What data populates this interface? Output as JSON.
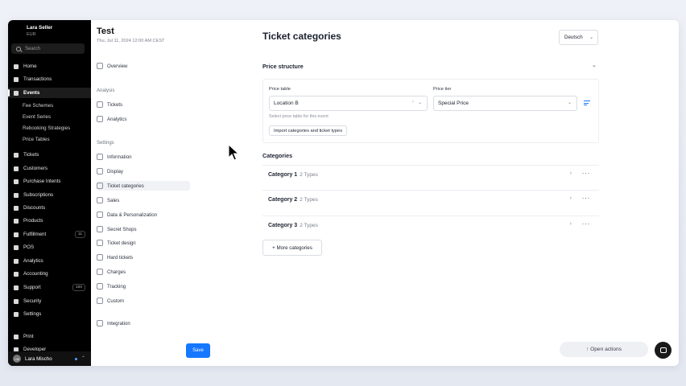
{
  "sidebar": {
    "account": {
      "name": "Lara Seller",
      "currency": "EUR"
    },
    "search_label": "Search",
    "items": [
      {
        "label": "Home",
        "icon": "home-icon"
      },
      {
        "label": "Transactions",
        "icon": "transactions-icon"
      },
      {
        "label": "Events",
        "icon": "events-icon",
        "active": true
      },
      {
        "label": "Fee Schemes",
        "sub": true
      },
      {
        "label": "Event Series",
        "sub": true
      },
      {
        "label": "Rebooking Strategies",
        "sub": true
      },
      {
        "label": "Price Tables",
        "sub": true
      },
      {
        "label": "Tickets",
        "icon": "tickets-icon"
      },
      {
        "label": "Customers",
        "icon": "customers-icon"
      },
      {
        "label": "Purchase Intents",
        "icon": "purchase-intents-icon"
      },
      {
        "label": "Subscriptions",
        "icon": "subscriptions-icon"
      },
      {
        "label": "Discounts",
        "icon": "discounts-icon"
      },
      {
        "label": "Products",
        "icon": "products-icon"
      },
      {
        "label": "Fulfillment",
        "icon": "fulfillment-icon",
        "badge": "11"
      },
      {
        "label": "POS",
        "icon": "pos-icon"
      },
      {
        "label": "Analytics",
        "icon": "analytics-icon"
      },
      {
        "label": "Accounting",
        "icon": "accounting-icon"
      },
      {
        "label": "Support",
        "icon": "support-icon",
        "badge": "100"
      },
      {
        "label": "Security",
        "icon": "security-icon"
      },
      {
        "label": "Settings",
        "icon": "settings-icon"
      },
      {
        "label": "Print",
        "icon": "print-icon"
      },
      {
        "label": "Developer",
        "icon": "developer-icon"
      }
    ],
    "user": {
      "name": "Lara Mischo",
      "initials": "LM"
    }
  },
  "event": {
    "title": "Test",
    "date": "Thu, Jul 11, 2024 12:00 AM CEST",
    "overview_label": "Overview",
    "analysis_section": "Analysis",
    "analysis_items": [
      "Tickets",
      "Analytics"
    ],
    "settings_section": "Settings",
    "settings_items": [
      "Information",
      "Display",
      "Ticket categories",
      "Sales",
      "Data & Personalization",
      "Secret Shops",
      "Ticket design",
      "Hard tickets",
      "Charges",
      "Tracking",
      "Custom"
    ],
    "integration_label": "Integration",
    "save_label": "Save"
  },
  "main": {
    "title": "Ticket categories",
    "language": "Deutsch",
    "price_structure": {
      "heading": "Price structure",
      "price_table_label": "Price table",
      "price_table_value": "Location B",
      "price_tier_label": "Price tier",
      "price_tier_value": "Special Price",
      "help_text": "Select price table for this event",
      "import_label": "Import categories and ticket types"
    },
    "categories_heading": "Categories",
    "categories": [
      {
        "name": "Category 1",
        "types": "2 Types"
      },
      {
        "name": "Category 2",
        "types": "2 Types"
      },
      {
        "name": "Category 3",
        "types": "2 Types"
      }
    ],
    "more_categories_label": "+ More categories",
    "open_actions_label": "↑ Open actions"
  },
  "colors": {
    "accent": "#1677ff",
    "sidebar_bg": "#000000"
  }
}
